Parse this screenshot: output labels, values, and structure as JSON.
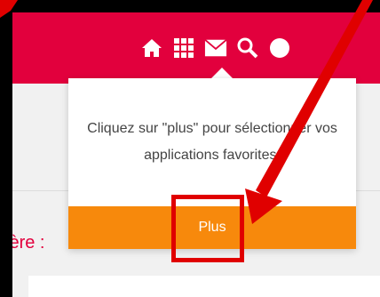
{
  "header": {
    "color": "#e2003d",
    "icons": [
      "home-icon",
      "grid-icon",
      "mail-icon",
      "search-icon",
      "user-icon"
    ]
  },
  "page": {
    "partial_heading": "ière :"
  },
  "popover": {
    "message": "Cliquez sur \"plus\" pour sélectionner vos applications favorites.",
    "button_label": "Plus",
    "button_color": "#f7890c"
  },
  "annotation": {
    "arrow_color": "#e00000"
  }
}
